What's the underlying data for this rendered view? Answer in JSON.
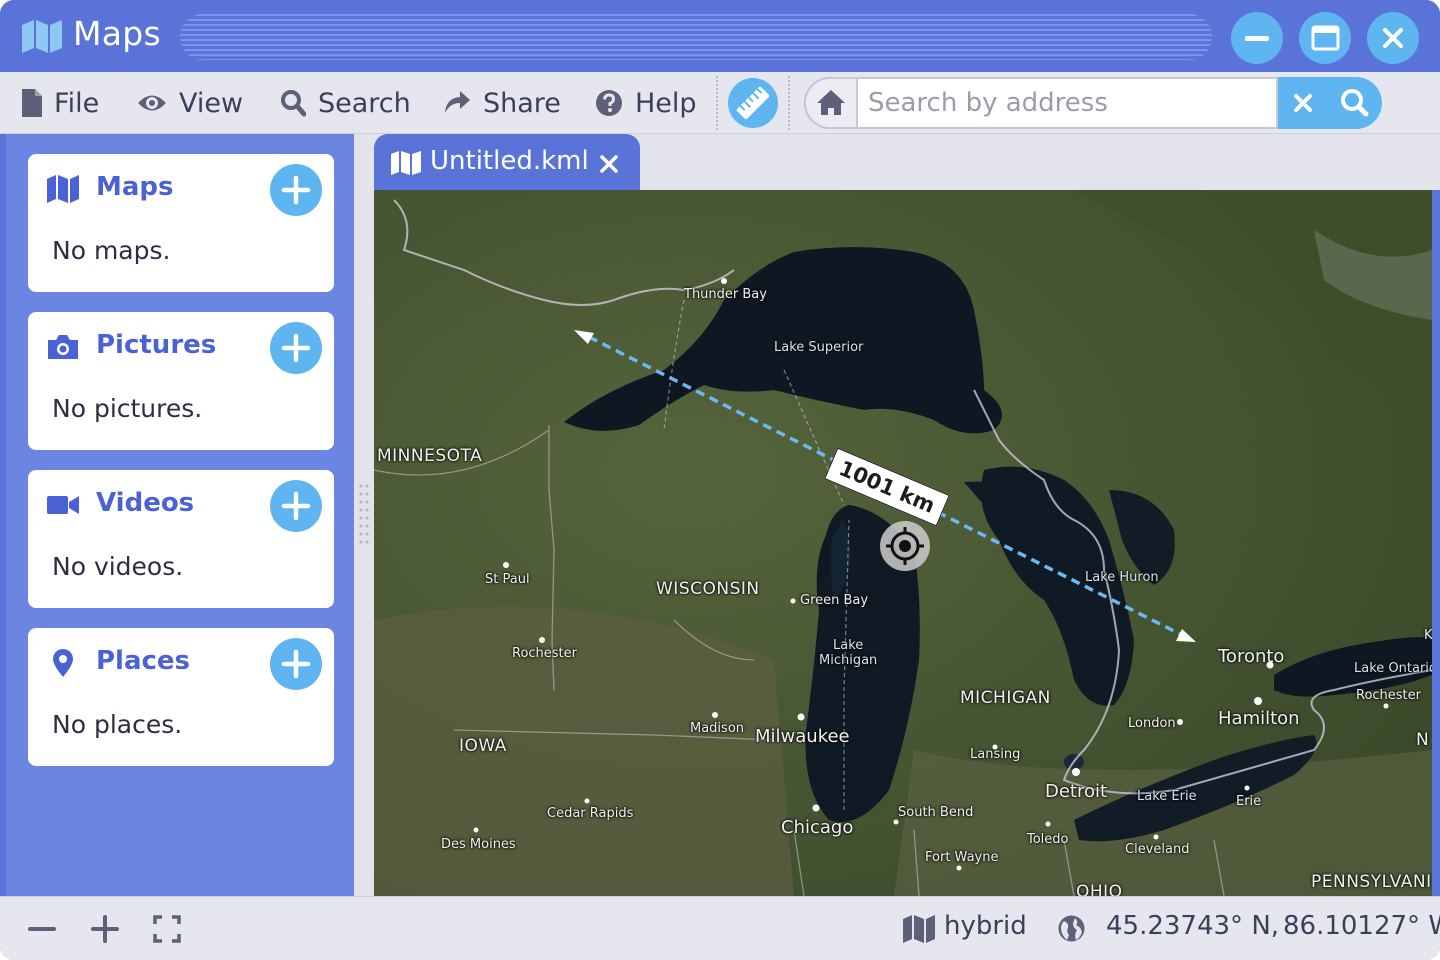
{
  "window": {
    "title": "Maps"
  },
  "menu": [
    {
      "label": "File",
      "icon": "file-icon"
    },
    {
      "label": "View",
      "icon": "eye-icon"
    },
    {
      "label": "Search",
      "icon": "search-icon"
    },
    {
      "label": "Share",
      "icon": "share-icon"
    },
    {
      "label": "Help",
      "icon": "help-icon"
    }
  ],
  "search": {
    "placeholder": "Search by address",
    "value": ""
  },
  "sidebar": {
    "sections": [
      {
        "title": "Maps",
        "icon": "map-icon",
        "empty": "No maps."
      },
      {
        "title": "Pictures",
        "icon": "camera-icon",
        "empty": "No pictures."
      },
      {
        "title": "Videos",
        "icon": "video-icon",
        "empty": "No videos."
      },
      {
        "title": "Places",
        "icon": "location-pin-icon",
        "empty": "No places."
      }
    ]
  },
  "tab": {
    "label": "Untitled.kml"
  },
  "map": {
    "distance": "1001 km",
    "labels": {
      "thunder_bay": "Thunder Bay",
      "lake_superior": "Lake Superior",
      "minnesota": "MINNESOTA",
      "st_paul": "St Paul",
      "wisconsin": "WISCONSIN",
      "green_bay": "Green Bay",
      "lake_michigan_1": "Lake",
      "lake_michigan_2": "Michigan",
      "lake_huron": "Lake Huron",
      "toronto": "Toronto",
      "lake_ontario": "Lake Ontario",
      "rochester_mn": "Rochester",
      "rochester_ny": "Rochester",
      "michigan": "MICHIGAN",
      "hamilton": "Hamilton",
      "london": "London",
      "madison": "Madison",
      "milwaukee": "Milwaukee",
      "iowa": "IOWA",
      "lansing": "Lansing",
      "detroit": "Detroit",
      "lake_erie": "Lake Erie",
      "erie": "Erie",
      "cedar_rapids": "Cedar Rapids",
      "south_bend": "South Bend",
      "chicago": "Chicago",
      "toledo": "Toledo",
      "des_moines": "Des Moines",
      "cleveland": "Cleveland",
      "fort_wayne": "Fort Wayne",
      "ohio": "OHIO",
      "pennsylvania": "PENNSYLVANI",
      "ny_partial": "N",
      "k_partial": "K"
    }
  },
  "status": {
    "map_type": "hybrid",
    "latitude": "45.23743° N,",
    "longitude": "86.10127° W"
  },
  "colors": {
    "accent": "#5a73d8",
    "button": "#5fb5ef",
    "sidebar": "#6a86e2",
    "section_title": "#4b62d6",
    "measure_line": "#6cb8f2"
  }
}
